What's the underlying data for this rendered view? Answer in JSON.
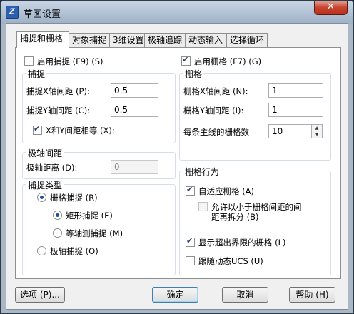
{
  "window": {
    "title": "草图设置",
    "close_label": "✕",
    "app_icon": "zw-app-icon"
  },
  "tabs": [
    {
      "label": "捕捉和栅格",
      "active": true
    },
    {
      "label": "对象捕捉"
    },
    {
      "label": "3维设置"
    },
    {
      "label": "极轴追踪"
    },
    {
      "label": "动态输入"
    },
    {
      "label": "选择循环"
    }
  ],
  "snap": {
    "enable_label": "启用捕捉 (F9) (S)",
    "enabled": false,
    "group_title": "捕捉",
    "x_spacing_label": "捕捉X轴间距 (P):",
    "x_spacing_value": "0.5",
    "y_spacing_label": "捕捉Y轴间距 (C):",
    "y_spacing_value": "0.5",
    "equal_label": "X和Y间距相等 (X):",
    "equal_checked": true
  },
  "polar": {
    "group_title": "极轴间距",
    "distance_label": "极轴距离 (D):",
    "distance_value": "0"
  },
  "snap_type": {
    "group_title": "捕捉类型",
    "grid_snap_label": "栅格捕捉 (R)",
    "rect_snap_label": "矩形捕捉 (E)",
    "iso_snap_label": "等轴测捕捉 (M)",
    "polar_snap_label": "极轴捕捉 (O)"
  },
  "grid": {
    "enable_label": "启用栅格 (F7) (G)",
    "enabled": true,
    "group_title": "栅格",
    "x_spacing_label": "栅格X轴间距 (N):",
    "x_spacing_value": "1",
    "y_spacing_label": "栅格Y轴间距 (I):",
    "y_spacing_value": "1",
    "major_label": "每条主线的栅格数",
    "major_value": "10"
  },
  "grid_behavior": {
    "group_title": "栅格行为",
    "adaptive_label": "自适应栅格 (A)",
    "subdivide_label_1": "允许以小于栅格间距的间",
    "subdivide_label_2": "距再拆分 (B)",
    "beyond_limits_label": "显示超出界限的栅格 (L)",
    "follow_ucs_label": "跟随动态UCS (U)"
  },
  "buttons": {
    "options": "选项 (P)...",
    "ok": "确定",
    "cancel": "取消",
    "help": "帮助 (H)"
  }
}
